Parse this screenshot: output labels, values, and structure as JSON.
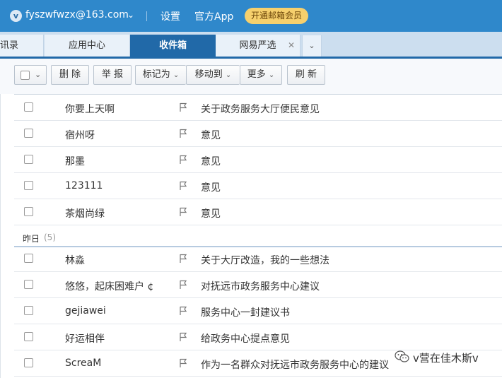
{
  "header": {
    "avatar_letter": "v",
    "account": "fyszwfwzx@163.com",
    "settings": "设置",
    "app": "官方App",
    "vip_button": "开通邮箱会员"
  },
  "tabs": {
    "contacts": "讯录",
    "apps": "应用中心",
    "inbox": "收件箱",
    "yanxuan": "网易严选"
  },
  "toolbar": {
    "delete": "删 除",
    "report": "举 报",
    "mark_as": "标记为",
    "move_to": "移动到",
    "more": "更多",
    "refresh": "刷 新"
  },
  "mails_today": [
    {
      "sender": "你要上天啊",
      "subject": "关于政务服务大厅便民意见"
    },
    {
      "sender": "宿州呀",
      "subject": "意见"
    },
    {
      "sender": "那墨",
      "subject": "意见"
    },
    {
      "sender": "123111",
      "subject": "意见"
    },
    {
      "sender": "茶烟尚绿",
      "subject": "意见"
    }
  ],
  "group_yesterday": {
    "label": "昨日",
    "count": "(5)"
  },
  "mails_yesterday": [
    {
      "sender": "林淼",
      "subject": "关于大厅改造，我的一些想法"
    },
    {
      "sender": "悠悠，起床困难户 ¢",
      "subject": "对抚远市政务服务中心建议"
    },
    {
      "sender": "gejiawei",
      "subject": "服务中心一封建议书"
    },
    {
      "sender": "好运相伴",
      "subject": "给政务中心提点意见"
    },
    {
      "sender": "ScreaM",
      "subject": "作为一名群众对抚远市政务服务中心的建议"
    }
  ],
  "watermark": "v营在佳木斯v",
  "colors": {
    "header_bg": "#2f88cb",
    "active_tab": "#2169a8",
    "vip_bg": "#f6d06d"
  }
}
